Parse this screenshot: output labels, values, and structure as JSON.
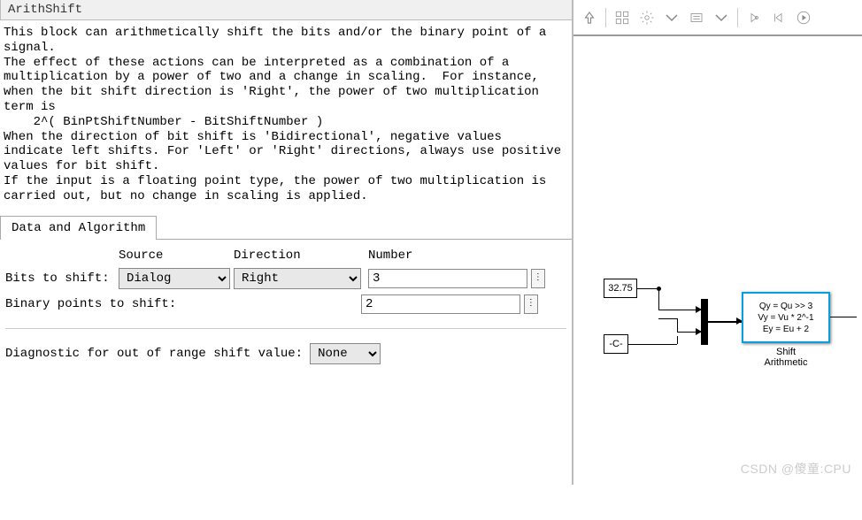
{
  "block": {
    "title": "ArithShift",
    "description": "This block can arithmetically shift the bits and/or the binary point of a signal.\nThe effect of these actions can be interpreted as a combination of a multiplication by a power of two and a change in scaling.  For instance, when the bit shift direction is 'Right', the power of two multiplication term is\n    2^( BinPtShiftNumber - BitShiftNumber )\nWhen the direction of bit shift is 'Bidirectional', negative values indicate left shifts. For 'Left' or 'Right' directions, always use positive values for bit shift.\nIf the input is a floating point type, the power of two multiplication is carried out, but no change in scaling is applied."
  },
  "tabs": {
    "active": "Data and Algorithm"
  },
  "headers": {
    "source": "Source",
    "direction": "Direction",
    "number": "Number"
  },
  "params": {
    "bits_label": "Bits to shift:",
    "bits_source": "Dialog",
    "bits_direction": "Right",
    "bits_number": "3",
    "binpt_label": "Binary points to shift:",
    "binpt_number": "2",
    "diag_label": "Diagnostic for out of range shift value:",
    "diag_value": "None"
  },
  "diagram": {
    "const1": "32.75",
    "const2": "-C-",
    "shift_line1": "Qy = Qu >> 3",
    "shift_line2": "Vy = Vu * 2^-1",
    "shift_line3": "Ey = Eu  + 2",
    "shift_name1": "Shift",
    "shift_name2": "Arithmetic"
  },
  "watermark": "CSDN @傻童:CPU"
}
